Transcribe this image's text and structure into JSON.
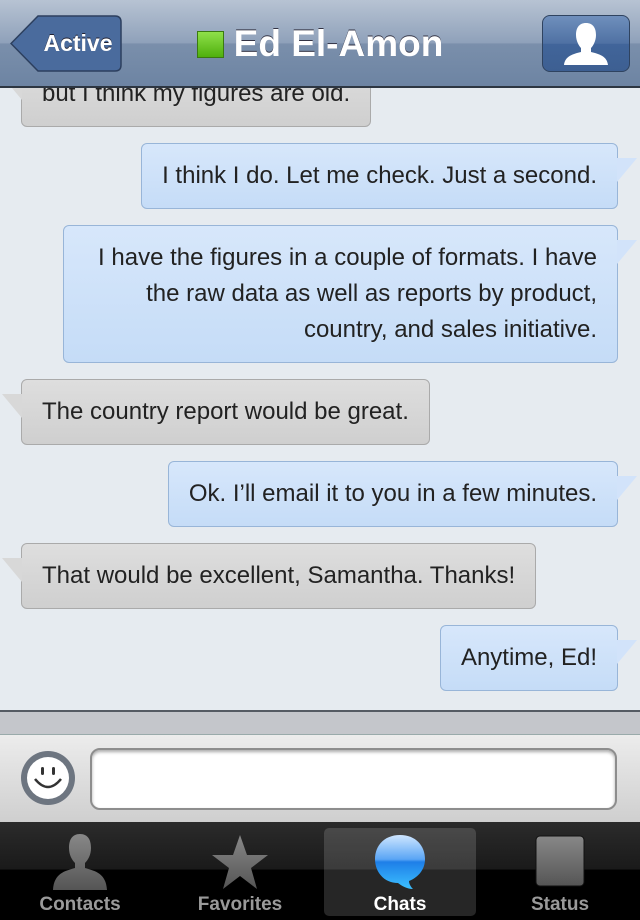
{
  "header": {
    "back_label": "Active",
    "title": "Ed El-Amon",
    "presence_color": "#5cc21a"
  },
  "messages": [
    {
      "dir": "in",
      "text": "but I think my figures are old."
    },
    {
      "dir": "out",
      "text": "I think I do. Let me check. Just a second."
    },
    {
      "dir": "out",
      "text": "I have the figures in a couple of formats. I have the raw data as well as reports by product, country, and sales initiative."
    },
    {
      "dir": "in",
      "text": "The country report would be great."
    },
    {
      "dir": "out",
      "text": "Ok. I’ll email it to you in a few minutes."
    },
    {
      "dir": "in",
      "text": "That would be excellent, Samantha. Thanks!"
    },
    {
      "dir": "out",
      "text": "Anytime, Ed!"
    }
  ],
  "composer": {
    "value": "",
    "placeholder": ""
  },
  "tabs": [
    {
      "label": "Contacts",
      "icon": "person-icon"
    },
    {
      "label": "Favorites",
      "icon": "star-icon"
    },
    {
      "label": "Chats",
      "icon": "chat-bubble-icon",
      "active": true
    },
    {
      "label": "Status",
      "icon": "status-square-icon"
    }
  ]
}
